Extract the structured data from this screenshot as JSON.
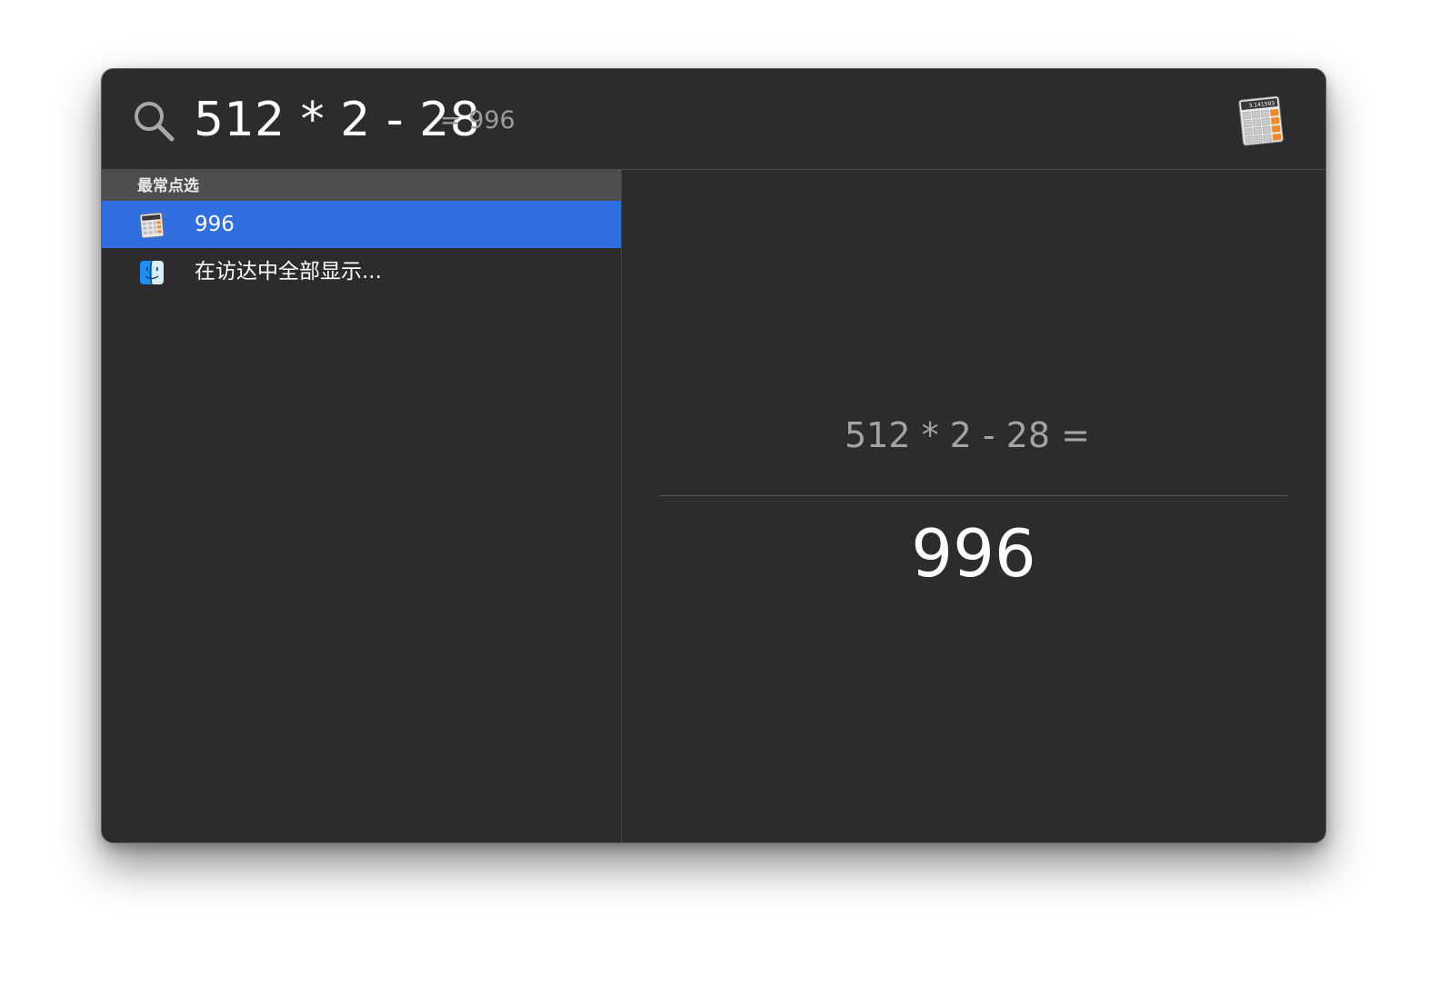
{
  "search": {
    "query": "512 * 2 - 28",
    "inline_result": "= 996",
    "app_icon": "calculator-icon"
  },
  "results": {
    "section_header": "最常点选",
    "items": [
      {
        "label": "996",
        "icon": "calculator-icon",
        "selected": true
      },
      {
        "label": "在访达中全部显示...",
        "icon": "finder-icon",
        "selected": false
      }
    ]
  },
  "preview": {
    "expression": "512 * 2 - 28 =",
    "result": "996"
  },
  "colors": {
    "window_bg": "#2c2c2e",
    "selection": "#2f6fe0",
    "section_header_bg": "#4e4e50"
  }
}
